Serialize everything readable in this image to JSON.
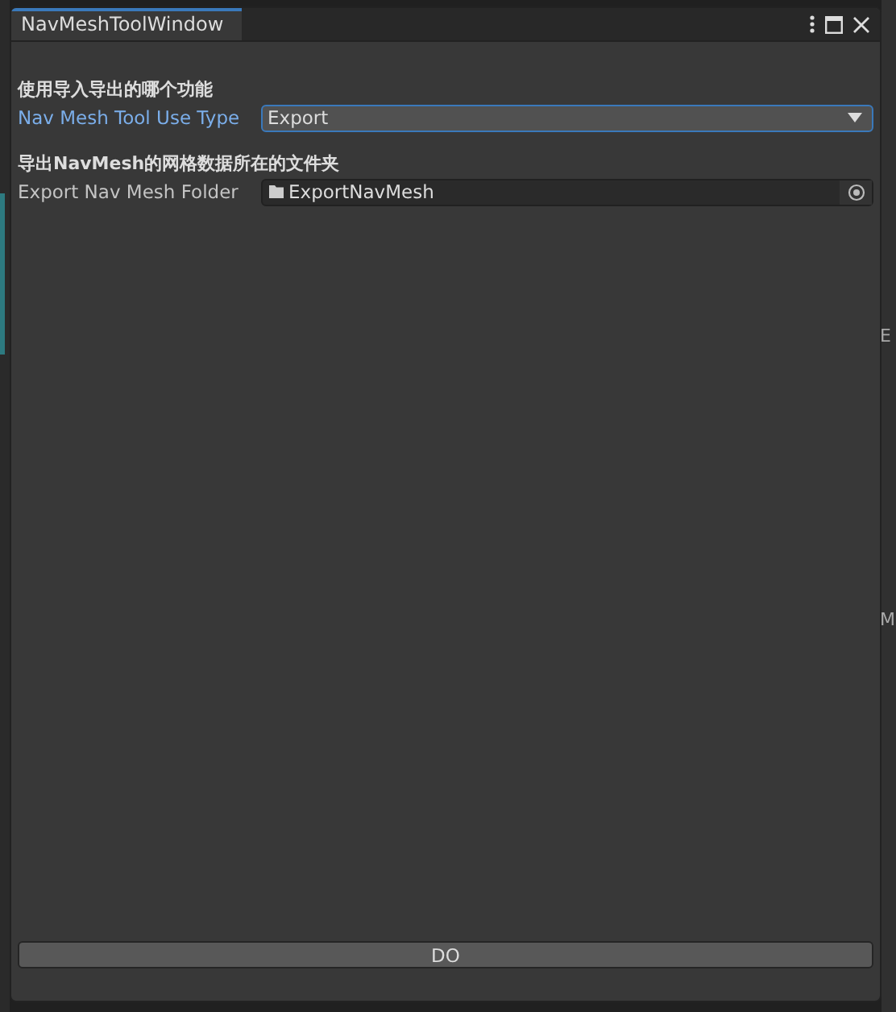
{
  "window": {
    "title": "NavMeshToolWindow"
  },
  "sections": [
    {
      "heading": "使用导入导出的哪个功能",
      "label": "Nav Mesh Tool Use Type",
      "kind": "dropdown",
      "value": "Export",
      "focused": true
    },
    {
      "heading": "导出NavMesh的网格数据所在的文件夹",
      "label": "Export Nav Mesh Folder",
      "kind": "folder",
      "value": "ExportNavMesh",
      "focused": false
    }
  ],
  "action_button": "DO",
  "background_fragments": [
    "E",
    "M"
  ]
}
